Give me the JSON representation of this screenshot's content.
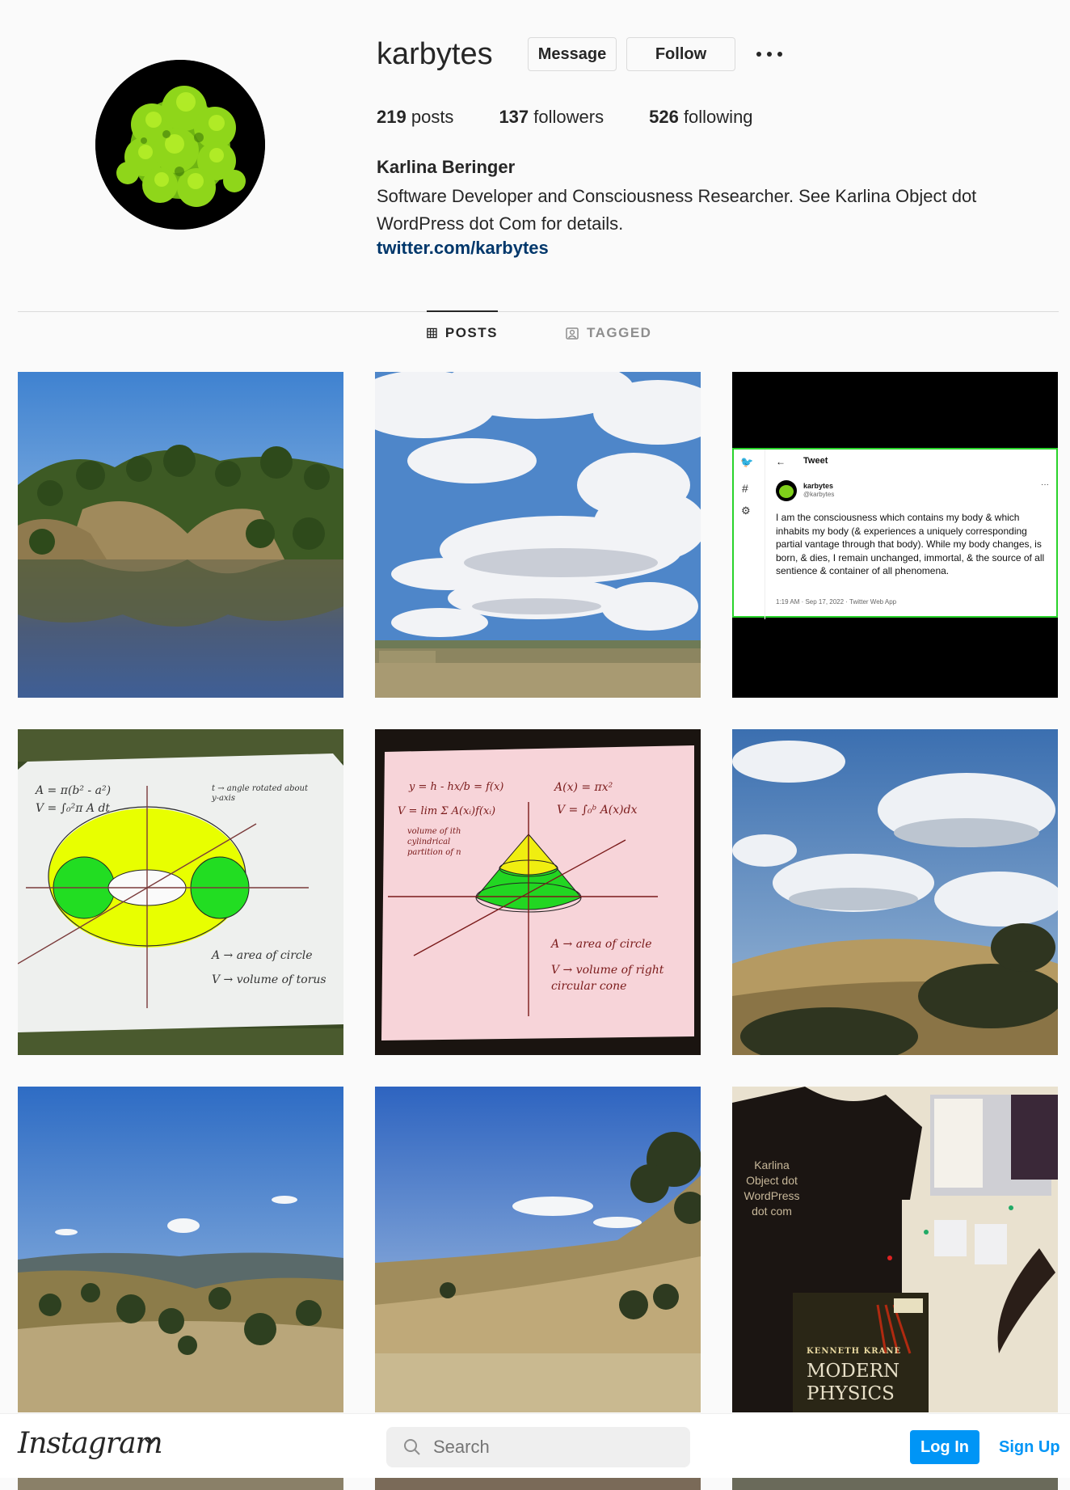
{
  "profile": {
    "username": "karbytes",
    "message_label": "Message",
    "follow_label": "Follow",
    "stats": {
      "posts_count": "219",
      "posts_label": "posts",
      "followers_count": "137",
      "followers_label": "followers",
      "following_count": "526",
      "following_label": "following"
    },
    "full_name": "Karlina Beringer",
    "bio": "Software Developer and Consciousness Researcher. See Karlina Object dot WordPress dot Com for details.",
    "link": "twitter.com/karbytes"
  },
  "tabs": [
    {
      "label": "POSTS",
      "icon": "grid-icon",
      "active": true
    },
    {
      "label": "TAGGED",
      "icon": "tagged-icon",
      "active": false
    }
  ],
  "posts": {
    "tweet": {
      "header": "Tweet",
      "name": "karbytes",
      "handle": "@karbytes",
      "text": "I am the consciousness which contains my body & which inhabits my body (& experiences a uniquely corresponding partial vantage through that body). While my body changes, is born, & dies, I remain unchanged, immortal, & the source of all sentience & container of all phenomena.",
      "meta": "1:19 AM · Sep 17, 2022 · Twitter Web App"
    },
    "torus": {
      "formula1": "A = π(b² - a²)",
      "formula2": "V = ∫₀²π A dt",
      "note": "t → angle rotated about y-axis",
      "legend1": "A → area of circle",
      "legend2": "V → volume of torus"
    },
    "cone": {
      "formula1": "y = h - hx/b = f(x)",
      "formula2": "A(x) = πx²",
      "formula3": "V = lim Σ A(xᵢ)f(xᵢ)",
      "formula4": "V = ∫₀ᵇ A(x)dx",
      "note": "volume of ith cylindrical partition of n",
      "legend1": "A → area of circle",
      "legend2": "V → volume of right circular cone"
    },
    "shirt": {
      "shirt_text": "Karlina Object dot WordPress dot com",
      "book_author": "KENNETH KRANE",
      "book_title": "MODERN PHYSICS"
    }
  },
  "bottom_bar": {
    "logo": "Instagram",
    "search_placeholder": "Search",
    "login_label": "Log In",
    "signup_label": "Sign Up"
  },
  "colors": {
    "primary_blue": "#0095f6",
    "link_blue": "#00376b",
    "border": "#dbdbdb"
  }
}
